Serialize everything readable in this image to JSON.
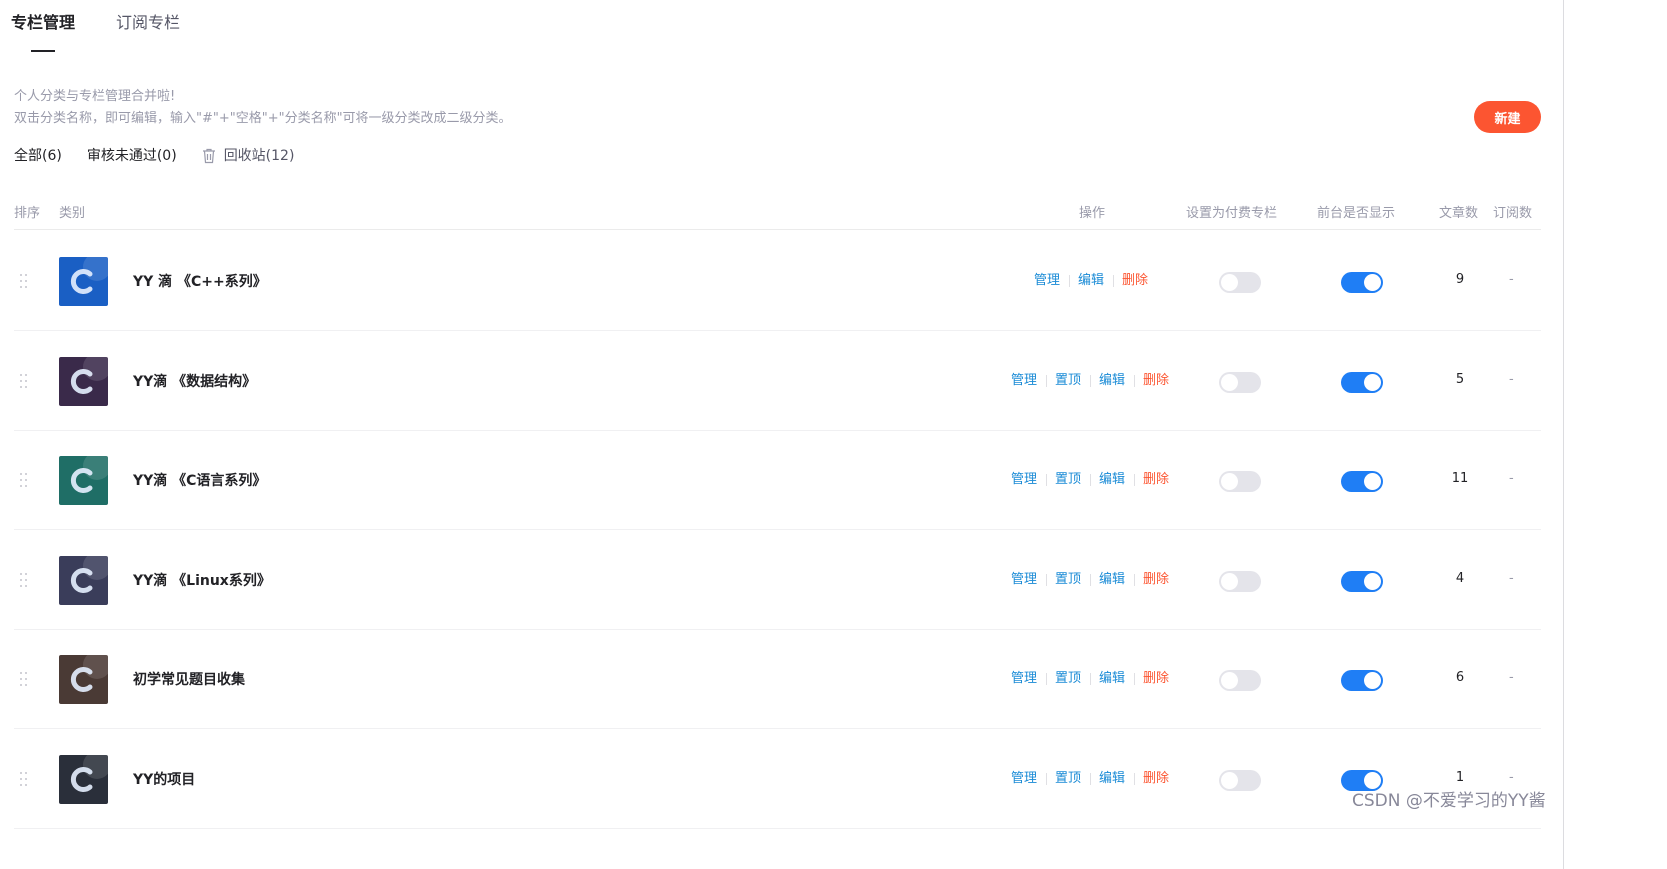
{
  "tabs": [
    {
      "label": "专栏管理",
      "active": true
    },
    {
      "label": "订阅专栏",
      "active": false
    }
  ],
  "notice": {
    "line1": "个人分类与专栏管理合并啦!",
    "line2": "双击分类名称，即可编辑，输入\"#\"+\"空格\"+\"分类名称\"可将一级分类改成二级分类。"
  },
  "new_button": "新建",
  "filters": {
    "all": "全部(6)",
    "rejected": "审核未通过(0)",
    "trash": "回收站(12)"
  },
  "table_headers": {
    "order": "排序",
    "category": "类别",
    "actions": "操作",
    "paid": "设置为付费专栏",
    "display": "前台是否显示",
    "articles": "文章数",
    "subscriptions": "订阅数"
  },
  "action_labels": {
    "manage": "管理",
    "pin": "置顶",
    "edit": "编辑",
    "delete": "删除"
  },
  "rows": [
    {
      "title": "YY 滴 《C++系列》",
      "pinned_first": true,
      "paid": false,
      "visible": true,
      "articles": "9",
      "subs": "-",
      "thumb_color": "#1a5fc4"
    },
    {
      "title": "YY滴 《数据结构》",
      "pinned_first": false,
      "paid": false,
      "visible": true,
      "articles": "5",
      "subs": "-",
      "thumb_color": "#3a2a4a"
    },
    {
      "title": "YY滴 《C语言系列》",
      "pinned_first": false,
      "paid": false,
      "visible": true,
      "articles": "11",
      "subs": "-",
      "thumb_color": "#1f6e66"
    },
    {
      "title": "YY滴 《Linux系列》",
      "pinned_first": false,
      "paid": false,
      "visible": true,
      "articles": "4",
      "subs": "-",
      "thumb_color": "#3a3d5a"
    },
    {
      "title": "初学常见题目收集",
      "pinned_first": false,
      "paid": false,
      "visible": true,
      "articles": "6",
      "subs": "-",
      "thumb_color": "#4a3a35"
    },
    {
      "title": "YY的项目",
      "pinned_first": false,
      "paid": false,
      "visible": true,
      "articles": "1",
      "subs": "-",
      "thumb_color": "#2a2f3a"
    }
  ],
  "watermark": "CSDN @不爱学习的YY酱",
  "colors": {
    "accent": "#fc5531",
    "link": "#1a8bd6",
    "toggle_on": "#1f7ef5",
    "toggle_off": "#e4e4ea"
  }
}
